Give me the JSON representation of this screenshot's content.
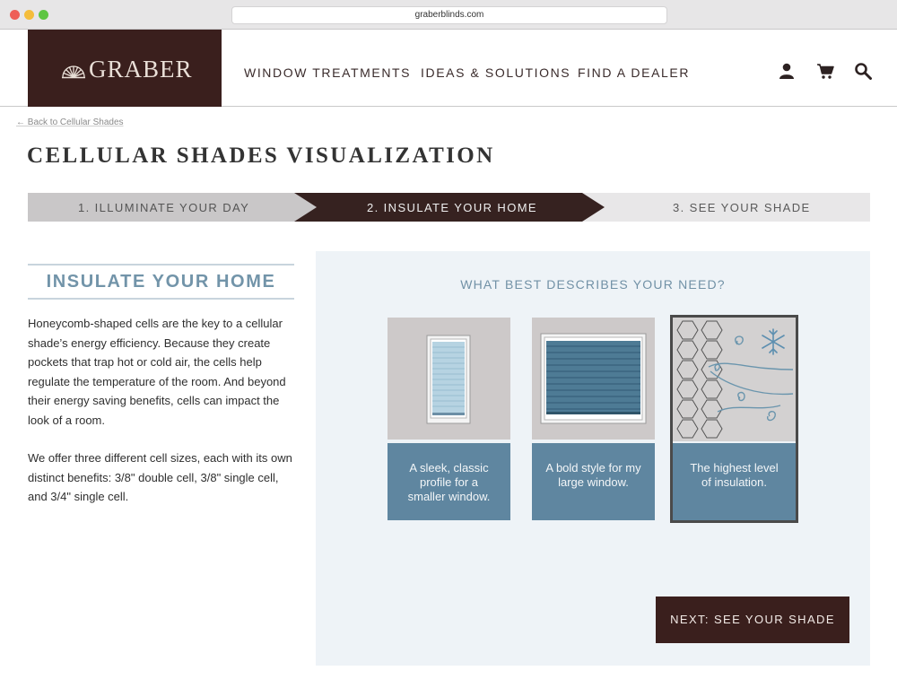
{
  "browser": {
    "url": "graberblinds.com"
  },
  "header": {
    "brand": "GRABER",
    "nav": [
      "WINDOW TREATMENTS",
      "IDEAS & SOLUTIONS",
      "FIND A DEALER"
    ],
    "icons": [
      "user-icon",
      "cart-icon",
      "search-icon"
    ]
  },
  "back_link": "← Back to Cellular Shades",
  "page_title": "CELLULAR SHADES VISUALIZATION",
  "steps": [
    {
      "label": "1. ILLUMINATE YOUR DAY",
      "state": "done"
    },
    {
      "label": "2. INSULATE YOUR HOME",
      "state": "active"
    },
    {
      "label": "3. SEE YOUR SHADE",
      "state": "upcoming"
    }
  ],
  "intro": {
    "heading": "INSULATE YOUR HOME",
    "paragraph1": "Honeycomb-shaped cells are the key to a cellular shade’s energy efficiency. Because they create pockets that trap hot or cold air, the cells help regulate the temperature of the room. And beyond their energy saving benefits, cells can impact the look of a room.",
    "paragraph2": "We offer three different cell sizes, each with its own distinct benefits: 3/8\" double cell, 3/8\" single cell, and 3/4\" single cell."
  },
  "question": "WHAT BEST DESCRIBES YOUR NEED?",
  "options": [
    {
      "caption": "A sleek, classic profile for a smaller window.",
      "selected": false
    },
    {
      "caption": "A bold style for my large window.",
      "selected": false
    },
    {
      "caption": "The highest level of insulation.",
      "selected": true
    }
  ],
  "next_button": "NEXT: SEE YOUR SHADE",
  "colors": {
    "brand": "#3a1f1d",
    "accent_blue": "#5f86a0",
    "heading_blue": "#7294a9",
    "panel_bg": "#eef3f7"
  }
}
